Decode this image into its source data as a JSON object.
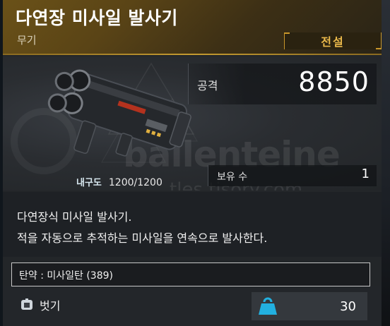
{
  "item": {
    "name": "다연장 미사일 발사기",
    "category": "무기",
    "grade": "전설"
  },
  "stats": {
    "attack_label": "공격",
    "attack_value": "8850",
    "owned_label": "보유 수",
    "owned_value": "1",
    "durability_label": "내구도",
    "durability_value": "1200/1200"
  },
  "watermark": {
    "line1": "ballenteine",
    "line2": "tles.tisory.com"
  },
  "description": {
    "line1": "다연장식 미사일 발사기.",
    "line2": "적을 자동으로 추적하는 미사일을 연속으로 발사한다."
  },
  "ammo": {
    "text": "탄약 : 미사일탄 (389)"
  },
  "footer": {
    "unequip_label": "벗기",
    "weight_value": "30"
  },
  "colors": {
    "header_gold": "#6a5118",
    "grade_gold": "#e9b84a",
    "weight_icon": "#22b0e0"
  }
}
